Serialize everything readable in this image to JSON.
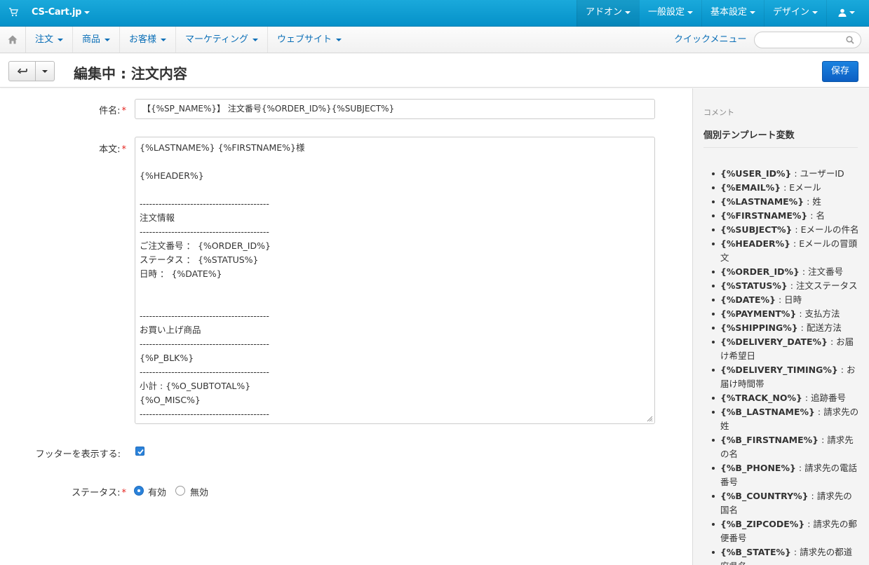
{
  "topbar": {
    "brand": "CS-Cart.jp",
    "nav": [
      "アドオン",
      "一般設定",
      "基本設定",
      "デザイン"
    ]
  },
  "subnav": {
    "menu": [
      "注文",
      "商品",
      "お客様",
      "マーケティング",
      "ウェブサイト"
    ],
    "quick_menu": "クイックメニュー",
    "search_placeholder": ""
  },
  "title_bar": {
    "title": "編集中 : 注文内容",
    "save_label": "保存"
  },
  "form": {
    "subject_label": "件名:",
    "subject_value": "【{%SP_NAME%}】 注文番号{%ORDER_ID%}{%SUBJECT%}",
    "body_label": "本文:",
    "body_lines": [
      "{%LASTNAME%} {%FIRSTNAME%}様",
      "",
      "{%HEADER%}",
      "",
      "-----------------------------------------",
      "注文情報",
      "-----------------------------------------",
      "ご注文番号 ： {%ORDER_ID%}",
      "ステータス ： {%STATUS%}",
      "日時 ： {%DATE%}",
      "",
      "",
      "-----------------------------------------",
      "お買い上げ商品",
      "-----------------------------------------",
      "{%P_BLK%}",
      "-----------------------------------------",
      "小計 : {%O_SUBTOTAL%}",
      "{%O_MISC%}",
      "-----------------------------------------"
    ],
    "footer_label": "フッターを表示する:",
    "footer_checked": true,
    "status_label": "ステータス:",
    "status_options": [
      "有効",
      "無効"
    ],
    "status_selected": "有効"
  },
  "sidebar": {
    "heading": "コメント",
    "title": "個別テンプレート変数",
    "vars": [
      {
        "code": "{%USER_ID%}",
        "desc": "ユーザーID"
      },
      {
        "code": "{%EMAIL%}",
        "desc": "Eメール"
      },
      {
        "code": "{%LASTNAME%}",
        "desc": "姓"
      },
      {
        "code": "{%FIRSTNAME%}",
        "desc": "名"
      },
      {
        "code": "{%SUBJECT%}",
        "desc": "Eメールの件名"
      },
      {
        "code": "{%HEADER%}",
        "desc": "Eメールの冒頭文"
      },
      {
        "code": "{%ORDER_ID%}",
        "desc": "注文番号"
      },
      {
        "code": "{%STATUS%}",
        "desc": "注文ステータス"
      },
      {
        "code": "{%DATE%}",
        "desc": "日時"
      },
      {
        "code": "{%PAYMENT%}",
        "desc": "支払方法"
      },
      {
        "code": "{%SHIPPING%}",
        "desc": "配送方法"
      },
      {
        "code": "{%DELIVERY_DATE%}",
        "desc": "お届け希望日"
      },
      {
        "code": "{%DELIVERY_TIMING%}",
        "desc": "お届け時間帯"
      },
      {
        "code": "{%TRACK_NO%}",
        "desc": "追跡番号"
      },
      {
        "code": "{%B_LASTNAME%}",
        "desc": "請求先の姓"
      },
      {
        "code": "{%B_FIRSTNAME%}",
        "desc": "請求先の名"
      },
      {
        "code": "{%B_PHONE%}",
        "desc": "請求先の電話番号"
      },
      {
        "code": "{%B_COUNTRY%}",
        "desc": "請求先の国名"
      },
      {
        "code": "{%B_ZIPCODE%}",
        "desc": "請求先の郵便番号"
      },
      {
        "code": "{%B_STATE%}",
        "desc": "請求先の都道府県名"
      }
    ]
  }
}
